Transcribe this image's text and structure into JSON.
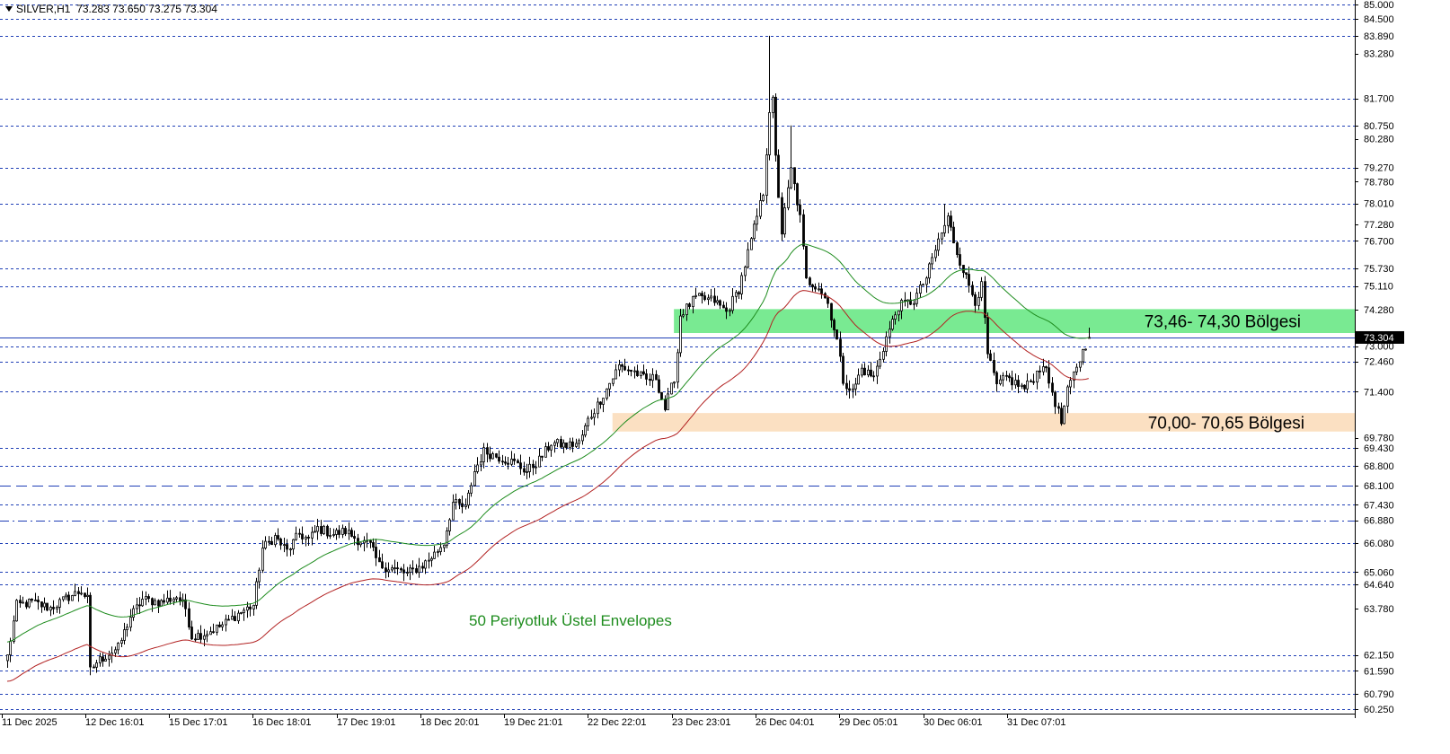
{
  "header": {
    "symbol": "SILVER,H1",
    "ohlc": "73.283 73.650 73.275 73.304"
  },
  "colors": {
    "grid": "#1f3fb6",
    "price_line": "#1f3fb6",
    "current_price_bg": "#000000",
    "candle": "#000000",
    "ema_upper": "#1e8c1e",
    "ema_lower": "#b22222",
    "zone_green": "#79ea92",
    "zone_orange": "#fbe0c2",
    "annotation": "#1e8c1e"
  },
  "chart_data": {
    "type": "candlestick",
    "symbol": "SILVER",
    "timeframe": "H1",
    "ylim": [
      60.25,
      85.0
    ],
    "current_price": 73.304,
    "x_tick_labels": [
      "11 Dec 2025",
      "12 Dec 16:01",
      "15 Dec 17:01",
      "16 Dec 18:01",
      "17 Dec 19:01",
      "18 Dec 20:01",
      "19 Dec 21:01",
      "22 Dec 22:01",
      "23 Dec 23:01",
      "26 Dec 04:01",
      "29 Dec 05:01",
      "30 Dec 06:01",
      "31 Dec 07:01"
    ],
    "y_tick_labels": [
      "85.000",
      "84.500",
      "83.890",
      "83.280",
      "81.700",
      "80.750",
      "80.280",
      "79.270",
      "78.780",
      "78.010",
      "77.280",
      "76.700",
      "75.730",
      "75.110",
      "74.280",
      "73.000",
      "72.460",
      "71.400",
      "69.780",
      "69.430",
      "68.800",
      "68.100",
      "67.430",
      "66.880",
      "66.080",
      "65.060",
      "64.640",
      "63.780",
      "62.150",
      "61.590",
      "60.790",
      "60.250"
    ],
    "horizontal_levels": [
      85.0,
      84.5,
      83.89,
      81.7,
      80.75,
      79.27,
      78.01,
      76.7,
      75.73,
      75.11,
      73.3,
      73.0,
      72.46,
      71.4,
      69.43,
      68.8,
      67.43,
      66.08,
      65.06,
      64.64,
      62.15,
      61.59,
      60.79,
      60.25
    ],
    "dashed_levels": [
      68.1,
      66.88
    ],
    "zones": [
      {
        "label": "73,46- 74,30 Bölgesi",
        "low": 73.46,
        "high": 74.3,
        "color": "#79ea92"
      },
      {
        "label": "70,00- 70,65 Bölgesi",
        "low": 70.0,
        "high": 70.65,
        "color": "#fbe0c2"
      }
    ],
    "indicator_label": "50 Periyotluk Üstel Envelopes",
    "anchors": [
      [
        0,
        62.1
      ],
      [
        3,
        63.9
      ],
      [
        8,
        64.0
      ],
      [
        14,
        63.8
      ],
      [
        20,
        64.2
      ],
      [
        24,
        64.4
      ],
      [
        26,
        64.1
      ],
      [
        27,
        61.6
      ],
      [
        29,
        61.9
      ],
      [
        33,
        62.2
      ],
      [
        36,
        62.4
      ],
      [
        40,
        63.5
      ],
      [
        44,
        64.1
      ],
      [
        50,
        64.0
      ],
      [
        55,
        64.2
      ],
      [
        58,
        63.8
      ],
      [
        60,
        62.8
      ],
      [
        64,
        62.9
      ],
      [
        70,
        63.2
      ],
      [
        75,
        63.6
      ],
      [
        80,
        63.9
      ],
      [
        83,
        65.9
      ],
      [
        87,
        66.3
      ],
      [
        91,
        65.8
      ],
      [
        95,
        66.4
      ],
      [
        98,
        66.2
      ],
      [
        101,
        66.6
      ],
      [
        106,
        66.4
      ],
      [
        110,
        66.5
      ],
      [
        114,
        66.2
      ],
      [
        118,
        66.0
      ],
      [
        121,
        65.3
      ],
      [
        125,
        65.2
      ],
      [
        130,
        65.0
      ],
      [
        135,
        65.3
      ],
      [
        139,
        65.7
      ],
      [
        142,
        66.1
      ],
      [
        145,
        67.5
      ],
      [
        149,
        67.3
      ],
      [
        152,
        68.6
      ],
      [
        155,
        69.3
      ],
      [
        160,
        69.1
      ],
      [
        165,
        68.9
      ],
      [
        169,
        68.6
      ],
      [
        173,
        69.0
      ],
      [
        177,
        69.6
      ],
      [
        182,
        69.5
      ],
      [
        186,
        69.6
      ],
      [
        189,
        70.4
      ],
      [
        194,
        71.3
      ],
      [
        199,
        72.3
      ],
      [
        204,
        72.1
      ],
      [
        208,
        71.8
      ],
      [
        211,
        71.9
      ],
      [
        214,
        70.8
      ],
      [
        217,
        71.9
      ],
      [
        218,
        72.8
      ],
      [
        219,
        74.1
      ],
      [
        224,
        74.7
      ],
      [
        230,
        74.6
      ],
      [
        234,
        74.2
      ],
      [
        238,
        75.0
      ],
      [
        242,
        76.7
      ],
      [
        246,
        78.4
      ],
      [
        248,
        81.3
      ],
      [
        249,
        81.6
      ],
      [
        250,
        79.6
      ],
      [
        252,
        77.0
      ],
      [
        255,
        79.2
      ],
      [
        258,
        77.5
      ],
      [
        260,
        75.3
      ],
      [
        264,
        75.1
      ],
      [
        267,
        74.5
      ],
      [
        270,
        73.2
      ],
      [
        272,
        71.8
      ],
      [
        275,
        71.4
      ],
      [
        278,
        72.2
      ],
      [
        282,
        71.9
      ],
      [
        286,
        73.3
      ],
      [
        290,
        74.4
      ],
      [
        295,
        74.6
      ],
      [
        299,
        75.4
      ],
      [
        303,
        76.7
      ],
      [
        306,
        77.5
      ],
      [
        309,
        76.3
      ],
      [
        312,
        75.4
      ],
      [
        315,
        74.6
      ],
      [
        317,
        75.1
      ],
      [
        319,
        72.7
      ],
      [
        322,
        71.6
      ],
      [
        325,
        71.9
      ],
      [
        328,
        71.7
      ],
      [
        331,
        71.5
      ],
      [
        334,
        71.9
      ],
      [
        337,
        72.4
      ],
      [
        340,
        71.4
      ],
      [
        343,
        70.3
      ],
      [
        345,
        71.4
      ],
      [
        348,
        72.3
      ],
      [
        350,
        72.8
      ],
      [
        352,
        73.3
      ]
    ],
    "spikes": [
      [
        248,
        83.9
      ],
      [
        255,
        80.75
      ],
      [
        305,
        78.0
      ],
      [
        287,
        73.5
      ]
    ]
  }
}
